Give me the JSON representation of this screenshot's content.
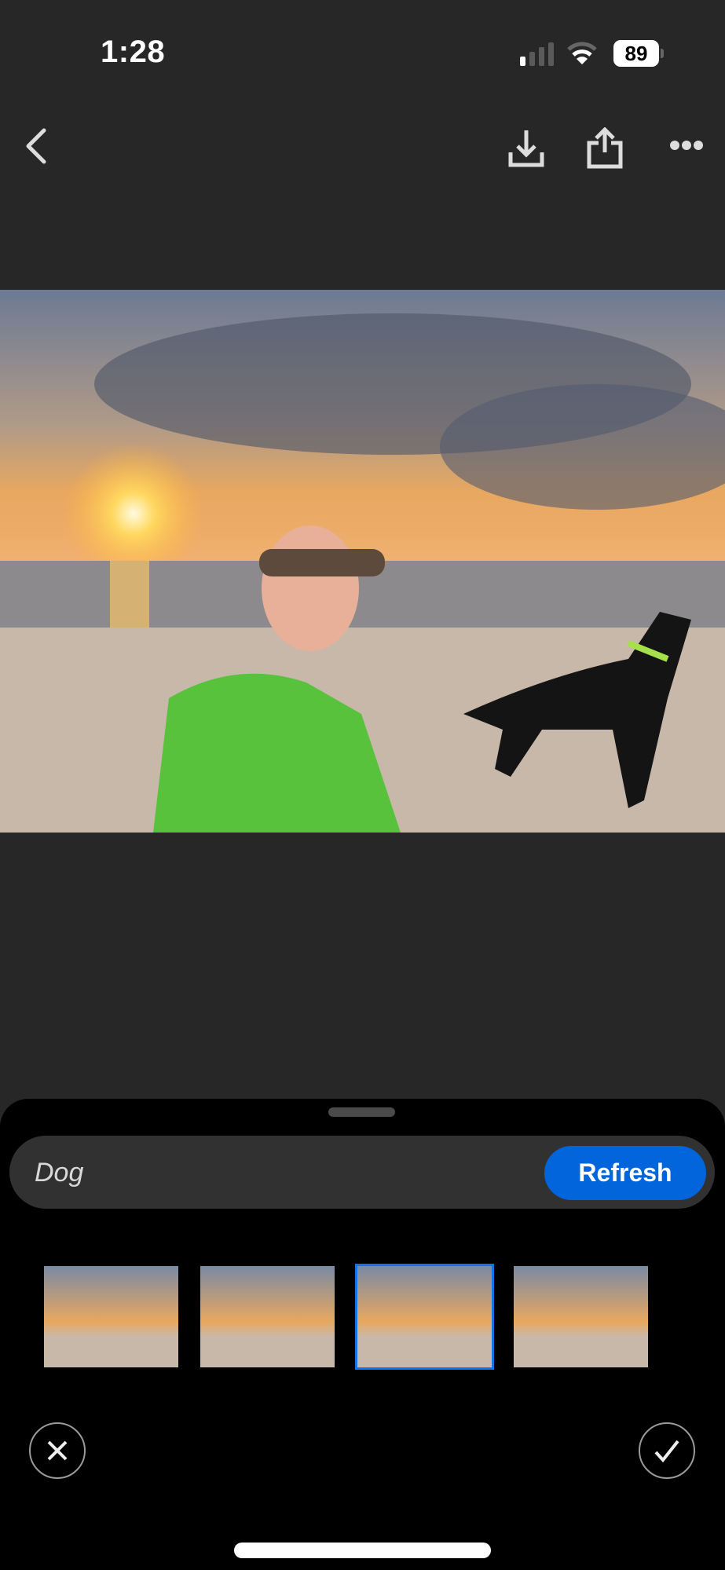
{
  "status_bar": {
    "time": "1:28",
    "battery": "89",
    "signal_bars_active": 1,
    "signal_bars_total": 4
  },
  "toolbar": {
    "back": "back-icon",
    "download": "download-icon",
    "share": "share-icon",
    "more": "more-icon"
  },
  "photo": {
    "description": "Woman in green hoodie and sunglasses with black and tan dog on beach at sunset"
  },
  "prompt_bar": {
    "value": "Dog",
    "refresh_label": "Refresh"
  },
  "variations": [
    {
      "label": "Variation 1",
      "selected": false
    },
    {
      "label": "Variation 2",
      "selected": false
    },
    {
      "label": "Variation 3",
      "selected": true
    },
    {
      "label": "Variation 4",
      "selected": false
    }
  ],
  "actions": {
    "cancel": "close-icon",
    "confirm": "checkmark-icon"
  },
  "colors": {
    "accent": "#0265dc",
    "selected_border": "#1473e6",
    "background": "#272727",
    "sheet": "#000000"
  }
}
